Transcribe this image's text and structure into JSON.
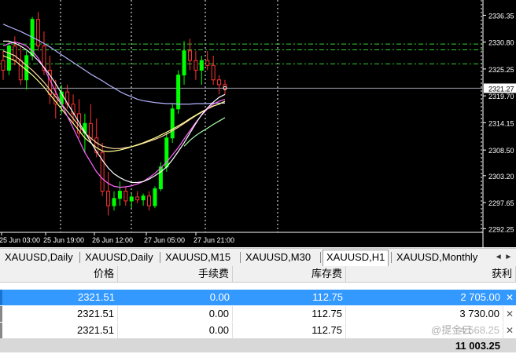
{
  "chart_data": {
    "type": "candlestick",
    "symbol_timeframe": "XAUUSD,H1",
    "ylim": [
      2291.5,
      2339.5
    ],
    "price_labels": [
      "2336.35",
      "2330.80",
      "2325.25",
      "2319.70",
      "2314.15",
      "2308.50",
      "2303.20",
      "2297.65",
      "2292.25"
    ],
    "price_label_values": [
      2336.35,
      2330.8,
      2325.25,
      2319.7,
      2314.15,
      2308.5,
      2303.2,
      2297.65,
      2292.25
    ],
    "current_price": "2321.27",
    "current_price_value": 2321.27,
    "time_labels": [
      "25 Jun 03:00",
      "25 Jun 19:00",
      "26 Jun 12:00",
      "27 Jun 05:00",
      "27 Jun 21:00"
    ],
    "horizontal_levels": [
      2330.4,
      2329.2,
      2326.3
    ],
    "candles": [
      [
        2327.0,
        2329.0,
        2323.0,
        2325.0
      ],
      [
        2325.0,
        2331.0,
        2324.0,
        2330.0
      ],
      [
        2330.0,
        2332.0,
        2326.0,
        2327.0
      ],
      [
        2327.0,
        2330.0,
        2322.0,
        2323.0
      ],
      [
        2323.0,
        2329.0,
        2321.0,
        2328.0
      ],
      [
        2328.0,
        2336.0,
        2327.0,
        2335.5
      ],
      [
        2335.5,
        2337.0,
        2329.0,
        2330.0
      ],
      [
        2330.0,
        2333.0,
        2324.0,
        2325.0
      ],
      [
        2325.0,
        2328.0,
        2318.0,
        2320.0
      ],
      [
        2320.0,
        2323.0,
        2315.0,
        2318.0
      ],
      [
        2318.0,
        2322.0,
        2316.0,
        2320.5
      ],
      [
        2320.5,
        2322.0,
        2317.0,
        2318.0
      ],
      [
        2318.0,
        2320.0,
        2314.0,
        2316.0
      ],
      [
        2316.0,
        2319.0,
        2311.0,
        2312.0
      ],
      [
        2312.0,
        2316.0,
        2308.0,
        2314.0
      ],
      [
        2314.0,
        2318.0,
        2310.0,
        2311.0
      ],
      [
        2311.0,
        2315.0,
        2307.0,
        2308.0
      ],
      [
        2308.0,
        2310.0,
        2299.0,
        2300.0
      ],
      [
        2300.0,
        2304.0,
        2295.0,
        2297.0
      ],
      [
        2297.0,
        2300.0,
        2296.0,
        2298.5
      ],
      [
        2298.5,
        2302.0,
        2297.0,
        2300.0
      ],
      [
        2300.0,
        2301.0,
        2297.0,
        2298.0
      ],
      [
        2298.0,
        2299.5,
        2296.5,
        2298.8
      ],
      [
        2298.8,
        2300.0,
        2297.5,
        2298.2
      ],
      [
        2298.2,
        2299.5,
        2297.0,
        2299.0
      ],
      [
        2299.0,
        2300.0,
        2296.0,
        2297.0
      ],
      [
        2297.0,
        2301.0,
        2296.5,
        2300.5
      ],
      [
        2300.5,
        2306.0,
        2300.0,
        2305.0
      ],
      [
        2305.0,
        2312.0,
        2304.0,
        2311.0
      ],
      [
        2311.0,
        2318.0,
        2310.0,
        2317.0
      ],
      [
        2317.0,
        2325.0,
        2316.0,
        2324.0
      ],
      [
        2324.0,
        2331.0,
        2322.0,
        2329.0
      ],
      [
        2329.0,
        2331.5,
        2325.0,
        2327.0
      ],
      [
        2327.0,
        2329.0,
        2323.0,
        2325.0
      ],
      [
        2325.0,
        2328.0,
        2322.0,
        2327.0
      ],
      [
        2327.0,
        2329.0,
        2325.0,
        2326.0
      ],
      [
        2326.0,
        2328.0,
        2322.0,
        2323.0
      ],
      [
        2323.0,
        2324.0,
        2320.0,
        2322.0
      ],
      [
        2322.0,
        2323.0,
        2320.0,
        2321.27
      ]
    ],
    "ma_lines": [
      {
        "color": "#b4b4ff",
        "values": [
          2334.5,
          2334,
          2333.5,
          2333,
          2332.4,
          2331.8,
          2331.2,
          2330.5,
          2329.8,
          2329,
          2328.2,
          2327.4,
          2326.6,
          2325.8,
          2325,
          2324.2,
          2323.5,
          2322.8,
          2322,
          2321.3,
          2320.6,
          2320,
          2319.5,
          2319,
          2318.7,
          2318.5,
          2318.3,
          2318.2,
          2318.1,
          2318.1,
          2318,
          2318,
          2318,
          2318.1,
          2318.1,
          2318.1,
          2318.2,
          2318.2,
          2318.2
        ]
      },
      {
        "color": "#ffd8a8",
        "values": [
          2329,
          2328.5,
          2328,
          2327,
          2326,
          2325,
          2323.8,
          2322.5,
          2321,
          2319.5,
          2318,
          2316.5,
          2315,
          2313.5,
          2312,
          2311,
          2310,
          2309.3,
          2309,
          2308.8,
          2308.8,
          2309,
          2309.2,
          2309.5,
          2309.9,
          2310.3,
          2310.7,
          2311.2,
          2311.8,
          2312.5,
          2313.2,
          2314,
          2314.8,
          2315.6,
          2316.3,
          2317,
          2317.6,
          2318,
          2318.5
        ]
      },
      {
        "color": "#ffff90",
        "values": [
          2328,
          2327.5,
          2327,
          2326,
          2325,
          2324,
          2322.8,
          2321.5,
          2320,
          2318.5,
          2317,
          2315.5,
          2314,
          2312.5,
          2311,
          2310,
          2309,
          2308.3,
          2308.2,
          2308.3,
          2308.5,
          2308.8,
          2309.2,
          2309.6,
          2310,
          2310.5,
          2311,
          2311.6,
          2312.2,
          2312.8,
          2313.5,
          2314.2,
          2315,
          2315.7,
          2316.4,
          2317,
          2317.6,
          2318,
          2318.6
        ]
      },
      {
        "color": "#ff66ff",
        "values": [
          2330,
          2330.5,
          2330.8,
          2330.5,
          2330,
          2329,
          2327.5,
          2325.5,
          2323,
          2320.5,
          2318,
          2315.5,
          2313,
          2310.5,
          2308,
          2306,
          2304,
          2302.6,
          2301.6,
          2301,
          2300.8,
          2300.9,
          2301.1,
          2301.5,
          2302,
          2302.8,
          2303.7,
          2304.8,
          2306,
          2307.5,
          2309,
          2310.8,
          2312.5,
          2314.2,
          2315.7,
          2317,
          2318,
          2318.6,
          2319
        ]
      },
      {
        "color": "#aaffaa",
        "values": [
          null,
          null,
          null,
          null,
          null,
          null,
          null,
          null,
          null,
          null,
          null,
          null,
          null,
          null,
          null,
          null,
          null,
          null,
          null,
          null,
          null,
          null,
          null,
          null,
          null,
          null,
          null,
          null,
          null,
          null,
          null,
          2309.3,
          2310.5,
          2311.5,
          2312.3,
          2313,
          2313.8,
          2314.5,
          2315.2
        ]
      },
      {
        "color": "#ffffff",
        "values": [
          2331,
          2331,
          2330.6,
          2330,
          2329.2,
          2328.2,
          2327,
          2325.6,
          2324,
          2322.2,
          2320.2,
          2318.2,
          2316.2,
          2314.2,
          2312.2,
          2310.2,
          2308.2,
          2306.4,
          2304.8,
          2303.6,
          2302.8,
          2302.2,
          2301.8,
          2301.8,
          2302,
          2302.5,
          2303.2,
          2304,
          2305,
          2306.5,
          2308.2,
          2310,
          2312,
          2314,
          2315.8,
          2317.2,
          2318.4,
          2319.4,
          2320
        ]
      }
    ]
  },
  "tabs": [
    "XAUUSD,Daily",
    "XAUUSD,Daily",
    "XAUUSD,M15",
    "XAUUSD,M30",
    "XAUUSD,H1",
    "XAUUSD,Monthly"
  ],
  "tab_scroll": "◄ ►",
  "table": {
    "headers": [
      "价格",
      "手续费",
      "库存费",
      "获利"
    ],
    "rows": [
      [
        "2321.51",
        "0.00",
        "112.75",
        "2 705.00"
      ],
      [
        "2321.51",
        "0.00",
        "112.75",
        "3 730.00"
      ],
      [
        "2321.51",
        "0.00",
        "112.75",
        "4 568.25"
      ]
    ],
    "total": "11 003.25"
  },
  "watermark": "@提金云"
}
